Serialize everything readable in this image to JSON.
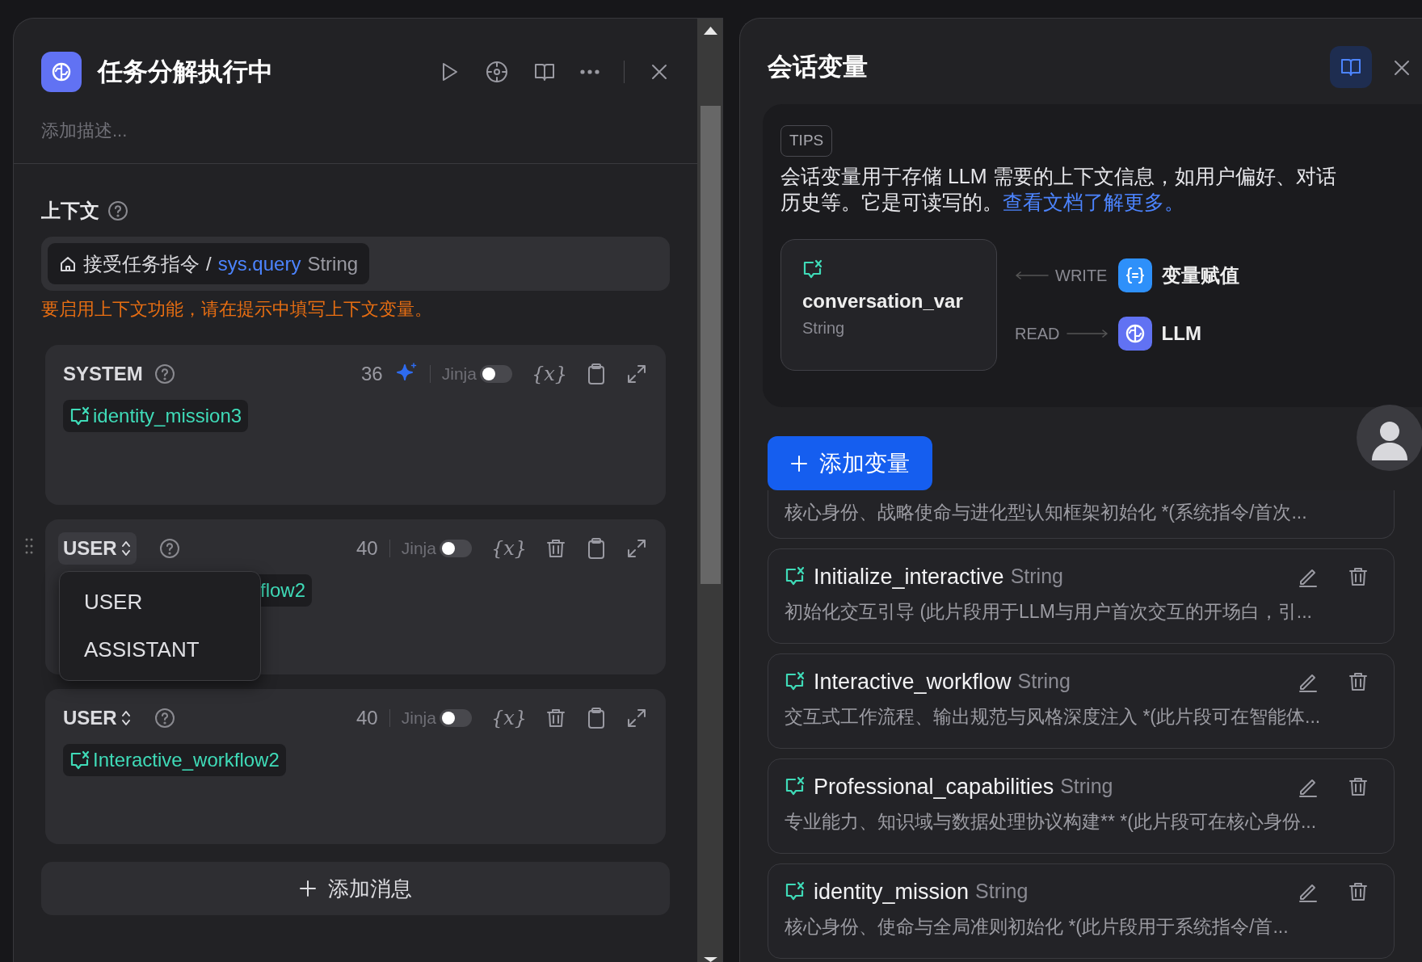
{
  "node_panel": {
    "title": "任务分解执行中",
    "description_placeholder": "添加描述...",
    "context": {
      "label": "上下文",
      "chip": {
        "node": "接受任务指令",
        "separator": "/",
        "variable": "sys.query",
        "type": "String"
      },
      "warning": "要启用上下文功能，请在提示中填写上下文变量。"
    },
    "messages": [
      {
        "role": "SYSTEM",
        "role_selectable": false,
        "open": false,
        "draggable": false,
        "count": "36",
        "generate": true,
        "jinja_label": "Jinja",
        "jinja_on": false,
        "insert_label": "{x}",
        "deletable": false,
        "variable": "identity_mission3",
        "variable_icon": true
      },
      {
        "role": "USER",
        "role_selectable": true,
        "open": true,
        "draggable": true,
        "count": "40",
        "generate": false,
        "jinja_label": "Jinja",
        "jinja_on": false,
        "insert_label": "{x}",
        "deletable": true,
        "variable": "flow2",
        "variable_icon": false
      },
      {
        "role": "USER",
        "role_selectable": true,
        "open": false,
        "draggable": false,
        "count": "40",
        "generate": false,
        "jinja_label": "Jinja",
        "jinja_on": false,
        "insert_label": "{x}",
        "deletable": true,
        "variable": "Interactive_workflow2",
        "variable_icon": true
      }
    ],
    "role_menu": [
      {
        "label": "USER",
        "selected": false
      },
      {
        "label": "ASSISTANT",
        "selected": false
      }
    ],
    "add_message": "添加消息"
  },
  "variables_panel": {
    "title": "会话变量",
    "docs_open": true,
    "tips": {
      "badge": "TIPS",
      "text": "会话变量用于存储 LLM 需要的上下文信息，如用户偏好、对话历史等。它是可读写的。",
      "link": "查看文档了解更多。"
    },
    "diagram": {
      "variable": "conversation_var",
      "type": "String",
      "write_label": "WRITE",
      "write_node": "变量赋值",
      "read_label": "READ",
      "read_node": "LLM"
    },
    "add_button": "添加变量",
    "variables": [
      {
        "kind": "partial",
        "description": "核心身份、战略使命与进化型认知框架初始化 *(系统指令/首次..."
      },
      {
        "kind": "full",
        "name": "Initialize_interactive",
        "type": "String",
        "description": "初始化交互引导 (此片段用于LLM与用户首次交互的开场白，引..."
      },
      {
        "kind": "full",
        "name": "Interactive_workflow",
        "type": "String",
        "description": "交互式工作流程、输出规范与风格深度注入 *(此片段可在智能体..."
      },
      {
        "kind": "full",
        "name": "Professional_capabilities",
        "type": "String",
        "description": "专业能力、知识域与数据处理协议构建** *(此片段可在核心身份..."
      },
      {
        "kind": "full",
        "name": "identity_mission",
        "type": "String",
        "description": "核心身份、使命与全局准则初始化 *(此片段用于系统指令/首..."
      }
    ]
  }
}
